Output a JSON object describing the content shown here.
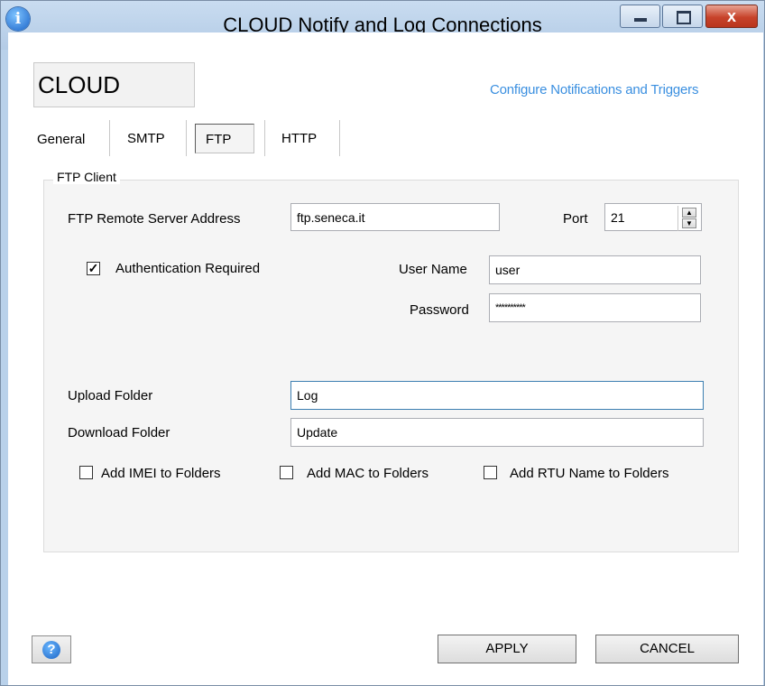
{
  "window": {
    "title": "CLOUD Notify and Log Connections",
    "info_icon": "info-icon",
    "controls": [
      "minimize-icon",
      "maximize-icon",
      "close-icon"
    ],
    "close_glyph": "x"
  },
  "header": {
    "cloud_label": "CLOUD",
    "configure_link": "Configure Notifications and Triggers"
  },
  "tabs": [
    {
      "label": "General",
      "active": false
    },
    {
      "label": "SMTP",
      "active": false
    },
    {
      "label": "FTP",
      "active": true
    },
    {
      "label": "HTTP",
      "active": false
    }
  ],
  "ftp_client": {
    "group_label": "FTP Client",
    "server_label": "FTP Remote Server Address",
    "server_value": "ftp.seneca.it",
    "port_label": "Port",
    "port_value": "21",
    "auth_label": "Authentication Required",
    "auth_checked": true,
    "username_label": "User Name",
    "username_value": "user",
    "password_label": "Password",
    "password_value": "**********",
    "upload_label": "Upload Folder",
    "upload_value": "Log",
    "download_label": "Download Folder",
    "download_value": "Update",
    "options": [
      {
        "label": "Add IMEI to Folders",
        "checked": false
      },
      {
        "label": "Add MAC to Folders",
        "checked": false
      },
      {
        "label": "Add RTU Name to Folders",
        "checked": false
      }
    ]
  },
  "footer": {
    "help_icon": "help-icon",
    "help_glyph": "?",
    "apply_label": "APPLY",
    "cancel_label": "CANCEL"
  },
  "colors": {
    "link": "#3a8fe0",
    "title_bar": "#b9d1ea",
    "close_button": "#c7432b",
    "focus_border": "#3c7fb1"
  }
}
